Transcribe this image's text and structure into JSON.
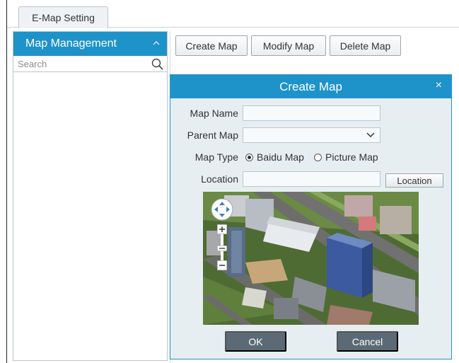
{
  "tabs": [
    {
      "label": "E-Map Setting"
    }
  ],
  "sidebar": {
    "title": "Map Management",
    "search_placeholder": "Search"
  },
  "toolbar": {
    "create_label": "Create Map",
    "modify_label": "Modify Map",
    "delete_label": "Delete Map"
  },
  "dialog": {
    "title": "Create Map",
    "close_glyph": "×",
    "map_name_label": "Map Name",
    "map_name_value": "",
    "parent_map_label": "Parent Map",
    "parent_map_value": "",
    "map_type_label": "Map Type",
    "map_type_options": [
      "Baidu Map",
      "Picture Map"
    ],
    "map_type_selected": "Baidu Map",
    "location_label": "Location",
    "location_value": "",
    "location_button": "Location",
    "ok_label": "OK",
    "cancel_label": "Cancel"
  },
  "colors": {
    "accent": "#1e93c9",
    "dialog_bg": "#e7eef2",
    "dialog_button": "#5b6a75"
  },
  "icons": {
    "sidebar_collapse": "chevron-up-icon",
    "search": "search-icon",
    "close": "close-icon",
    "select": "chevron-down-icon",
    "map_pan": "pan-control-icon",
    "zoom_in": "zoom-in-icon",
    "zoom_out": "zoom-out-icon"
  }
}
